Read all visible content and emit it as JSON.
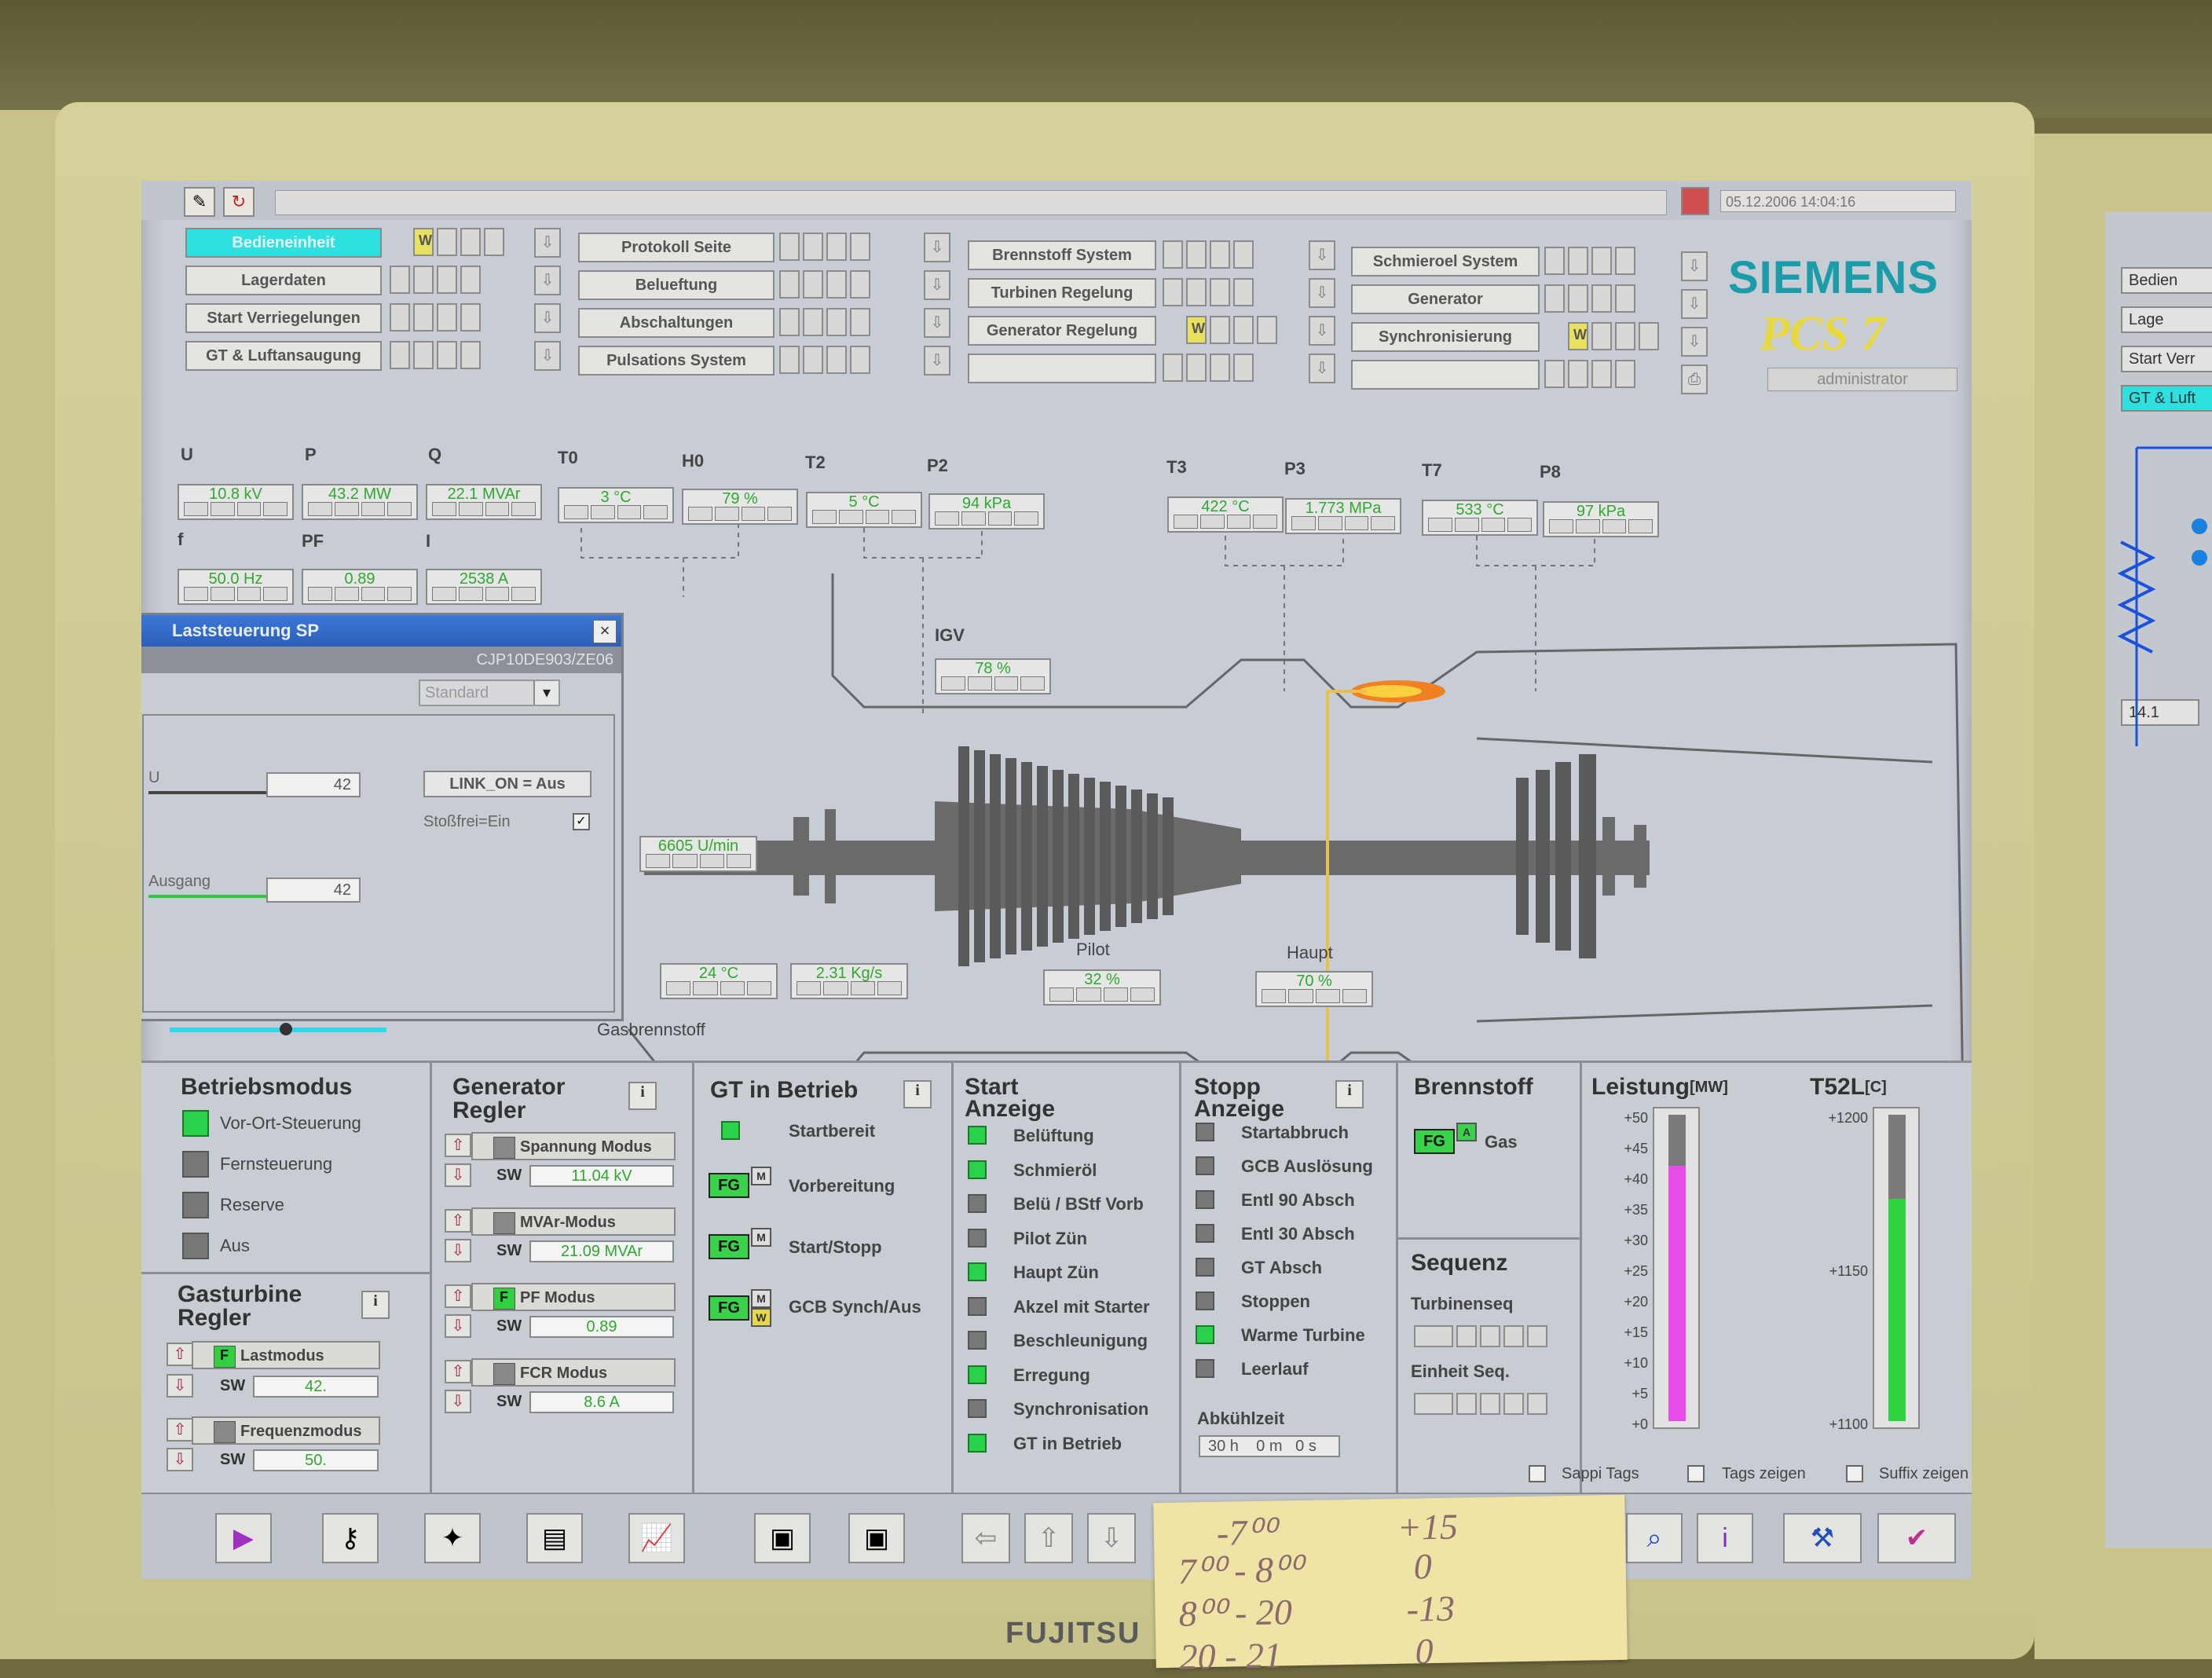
{
  "header": {
    "datetime": "05.12.2006 14:04:16",
    "brand": "SIEMENS",
    "product": "PCS 7",
    "user": "administrator",
    "nav_col1": [
      "Bedieneinheit",
      "Lagerdaten",
      "Start Verriegelungen",
      "GT & Luftansaugung"
    ],
    "nav_col2": [
      "Protokoll Seite",
      "Belueftung",
      "Abschaltungen",
      "Pulsations System"
    ],
    "nav_col3": [
      "Brennstoff System",
      "Turbinen Regelung",
      "Generator Regelung",
      ""
    ],
    "nav_col4": [
      "Schmieroel System",
      "Generator",
      "Synchronisierung",
      ""
    ]
  },
  "process": {
    "labels": {
      "U": "U",
      "P": "P",
      "Q": "Q",
      "T0": "T0",
      "H0": "H0",
      "T2": "T2",
      "P2": "P2",
      "T3": "T3",
      "P3": "P3",
      "T7": "T7",
      "P8": "P8",
      "f": "f",
      "PF": "PF",
      "I": "I",
      "IGV": "IGV",
      "pilot": "Pilot",
      "haupt": "Haupt",
      "gasbrennstoff": "Gasbrennstoff"
    },
    "values": {
      "U": "10.8 kV",
      "P": "43.2 MW",
      "Q": "22.1 MVAr",
      "T0": "3 °C",
      "H0": "79 %",
      "T2": "5 °C",
      "P2": "94 kPa",
      "T3": "422 °C",
      "P3": "1.773 MPa",
      "T7": "533 °C",
      "P8": "97 kPa",
      "f": "50.0 Hz",
      "PF": "0.89",
      "I": "2538 A",
      "IGV": "78 %",
      "speed": "6605 U/min",
      "gas_temp": "24 °C",
      "gas_flow": "2.31 Kg/s",
      "pilot": "32 %",
      "haupt": "70 %"
    }
  },
  "faceplate": {
    "title": "Laststeuerung SP",
    "tag": "CJP10DE903/ZE06",
    "dropdown": "Standard",
    "u_label": "U",
    "u_value": "42",
    "link_status": "LINK_ON = Aus",
    "stossfrei_label": "Stoßfrei=Ein",
    "ausgang_label": "Ausgang",
    "ausgang_value": "42"
  },
  "betriebsmodus": {
    "title": "Betriebsmodus",
    "items": [
      "Vor-Ort-Steuerung",
      "Fernsteuerung",
      "Reserve",
      "Aus"
    ]
  },
  "generator_regler": {
    "title_1": "Generator",
    "title_2": "Regler",
    "info": "i",
    "modes": [
      {
        "label": "Spannung Modus",
        "sw": "11.04 kV"
      },
      {
        "label": "MVAr-Modus",
        "sw": "21.09 MVAr"
      },
      {
        "label": "PF Modus",
        "sw": "0.89"
      },
      {
        "label": "FCR Modus",
        "sw": "8.6 A"
      }
    ],
    "sw_label": "SW"
  },
  "gasturbine_regler": {
    "title_1": "Gasturbine",
    "title_2": "Regler",
    "info": "i",
    "modes": [
      {
        "label": "Lastmodus",
        "sw": "42."
      },
      {
        "label": "Frequenzmodus",
        "sw": "50."
      }
    ],
    "sw_label": "SW"
  },
  "gt_in_betrieb": {
    "title": "GT in Betrieb",
    "info": "i",
    "items": [
      "Startbereit",
      "Vorbereitung",
      "Start/Stopp",
      "GCB Synch/Aus"
    ],
    "fg": "FG",
    "m": "M",
    "w": "W"
  },
  "start_anzeige": {
    "title_1": "Start",
    "title_2": "Anzeige",
    "items": [
      "Belüftung",
      "Schmieröl",
      "Belü / BStf Vorb",
      "Pilot Zün",
      "Haupt Zün",
      "Akzel mit Starter",
      "Beschleunigung",
      "Erregung",
      "Synchronisation",
      "GT in Betrieb"
    ],
    "states": [
      true,
      true,
      false,
      false,
      true,
      false,
      false,
      true,
      false,
      true
    ]
  },
  "stopp_anzeige": {
    "title_1": "Stopp",
    "title_2": "Anzeige",
    "info": "i",
    "items": [
      "Startabbruch",
      "GCB Auslösung",
      "Entl 90 Absch",
      "Entl 30 Absch",
      "GT Absch",
      "Stoppen",
      "Warme Turbine",
      "Leerlauf"
    ],
    "states": [
      false,
      false,
      false,
      false,
      false,
      false,
      true,
      false
    ],
    "abkuehlzeit_label": "Abkühlzeit",
    "abkuehlzeit": "30 h    0 m   0 s"
  },
  "brennstoff": {
    "title": "Brennstoff",
    "fg": "FG",
    "a": "A",
    "fuel": "Gas",
    "sequenz_title": "Sequenz",
    "turbinenseq": "Turbinenseq",
    "einheit_seq": "Einheit Seq."
  },
  "leistung": {
    "title": "Leistung",
    "unit": "[MW]",
    "scale": [
      "+50",
      "+45",
      "+40",
      "+35",
      "+30",
      "+25",
      "+20",
      "+15",
      "+10",
      "+5",
      "+0"
    ],
    "value_fraction": 0.86,
    "color": "#e84ce8"
  },
  "t52l": {
    "title": "T52L",
    "unit": "[C]",
    "scale": [
      "+1200",
      "+1150",
      "+1100"
    ],
    "value_fraction": 0.75,
    "color": "#2fd23f"
  },
  "checkboxes": [
    "Sappi Tags",
    "Tags zeigen",
    "Suffix zeigen"
  ],
  "note": {
    "lines": [
      [
        "-7⁰⁰",
        "+15"
      ],
      [
        "7⁰⁰ - 8⁰⁰",
        "0"
      ],
      [
        "8⁰⁰ - 20",
        "-13"
      ],
      [
        "20 - 21",
        "0"
      ]
    ]
  },
  "monitor": {
    "brand": "FUJITSU"
  },
  "right_screen": [
    "Bedien",
    "Lage",
    "Start Verr",
    "GT & Luft",
    "14.1"
  ]
}
